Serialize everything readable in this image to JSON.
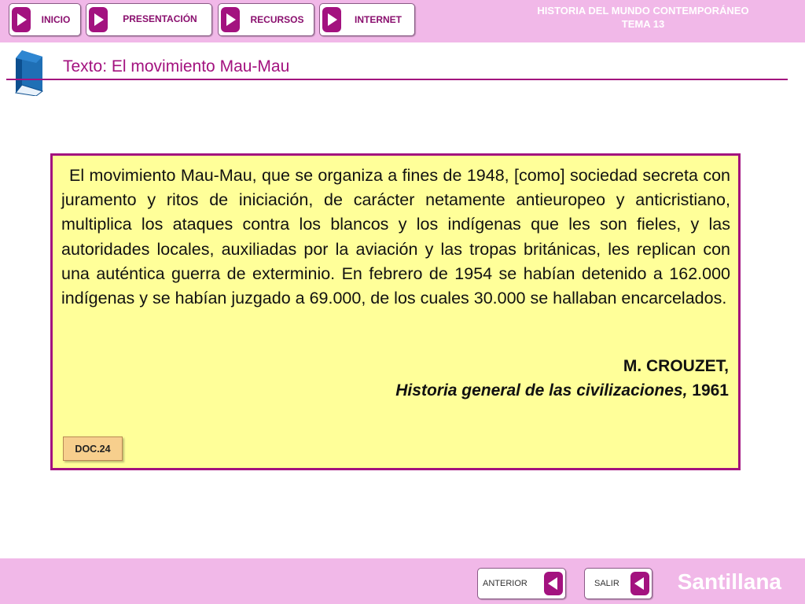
{
  "header": {
    "nav": [
      {
        "label": "INICIO"
      },
      {
        "label": "PRESENTACIÓN"
      },
      {
        "label": "RECURSOS"
      },
      {
        "label": "INTERNET"
      }
    ],
    "title_line1": "HISTORIA DEL MUNDO CONTEMPORÁNEO",
    "title_line2": "TEMA 13"
  },
  "section": {
    "title": "Texto: El movimiento Mau-Mau",
    "icon": "book-icon"
  },
  "document": {
    "body": "El movimiento Mau-Mau, que se organiza a fines de 1948, [como] sociedad secreta con juramento y ritos de iniciación, de carácter netamente antieuropeo y anticristiano, multiplica los ataques contra los blancos y los indígenas que les son fieles, y las autoridades locales, auxiliadas por la aviación y las tropas británicas, les replican con una auténtica guerra de exterminio. En febrero de 1954 se habían detenido a 162.000 indígenas y se habían juzgado a 69.000, de los cuales 30.000 se hallaban encarcelados.",
    "author": "M. CROUZET,",
    "source_title": "Historia general de las civilizaciones,",
    "source_year": " 1961",
    "badge": "DOC.24"
  },
  "footer": {
    "prev_label": "ANTERIOR",
    "exit_label": "SALIR",
    "brand": "Santillana"
  },
  "colors": {
    "accent": "#a3127f",
    "bar": "#f1b8e8",
    "doc_background": "#ffff99",
    "badge": "#f7cf8d"
  }
}
